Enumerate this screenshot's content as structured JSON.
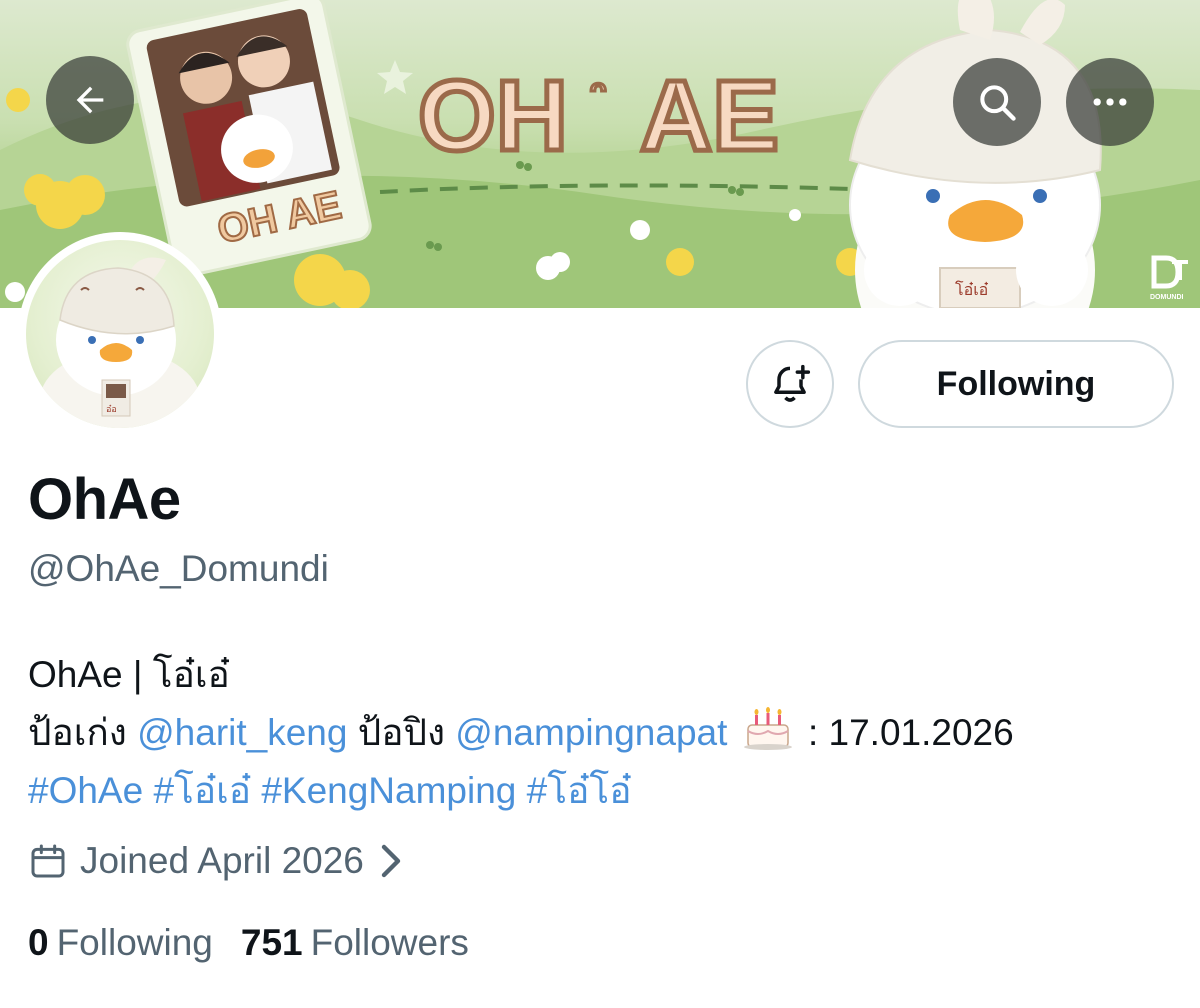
{
  "banner": {
    "title_art": "OH AE",
    "card_title_art": "OH AE",
    "hat_text": "โอ๋เอ๋",
    "brand_mark": "DOMUNDI"
  },
  "nav": {
    "back_icon": "arrow-left-icon",
    "search_icon": "search-icon",
    "more_icon": "more-horizontal-icon"
  },
  "actions": {
    "notify_icon": "bell-plus-icon",
    "following_label": "Following"
  },
  "profile": {
    "display_name": "OhAe",
    "handle": "@OhAe_Domundi",
    "bio": {
      "line1": "OhAe | โอ๋เอ๋",
      "line2_prefix": "ป้อเก่ง ",
      "mention1": "@harit_keng",
      "line2_mid": " ป้อปิง ",
      "mention2": "@nampingnapat",
      "birthday_icon": "birthday-cake-icon",
      "birthday_text": " : 17.01.2026",
      "hashtags": [
        "#OhAe",
        "#โอ๋เอ๋",
        "#KengNamping",
        "#โอ๋โอ๋"
      ]
    },
    "joined_icon": "calendar-icon",
    "joined": "Joined April 2026",
    "following_count": "0",
    "following_label": "Following",
    "followers_count": "751",
    "followers_label": "Followers"
  },
  "colors": {
    "link": "#4a90d9",
    "secondary_text": "#536471",
    "primary_text": "#0f1419",
    "button_border": "#cfd9de"
  }
}
